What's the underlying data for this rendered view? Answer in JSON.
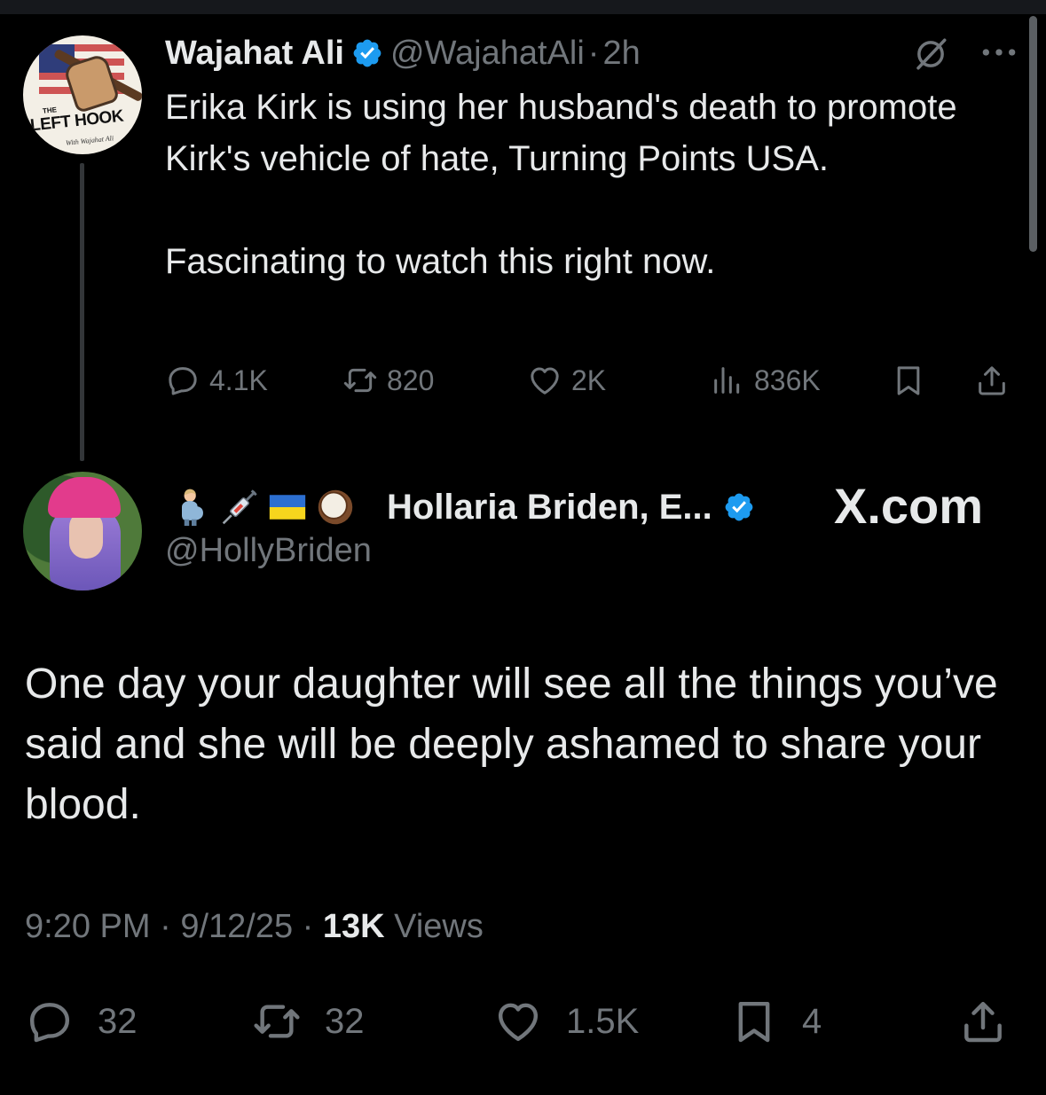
{
  "parent": {
    "avatar_label": "THE LEFT HOOK",
    "name": "Wajahat Ali",
    "handle": "@WajahatAli",
    "separator": "·",
    "time": "2h",
    "text": "Erika Kirk is using her husband's death to promote Kirk's vehicle of hate, Turning Points USA.\n\nFascinating to watch this right now.",
    "replies": "4.1K",
    "reposts": "820",
    "likes": "2K",
    "views": "836K"
  },
  "main": {
    "emojis": [
      "pregnant-man-emoji",
      "syringe-emoji",
      "ukraine-flag-emoji",
      "coconut-emoji"
    ],
    "name": "Hollaria Briden, E...",
    "handle": "@HollyBriden",
    "watermark": "X.com",
    "text": "One day your daughter will see all the things you’ve said and she will be deeply ashamed to share your blood.",
    "time": "9:20 PM",
    "sep": "·",
    "date": "9/12/25",
    "views_count": "13K",
    "views_label": "Views",
    "replies": "32",
    "reposts": "32",
    "likes": "1.5K",
    "bookmarks": "4"
  },
  "colors": {
    "background": "#000000",
    "text": "#e7e9ea",
    "muted": "#71767b",
    "verified": "#1d9bf0"
  }
}
